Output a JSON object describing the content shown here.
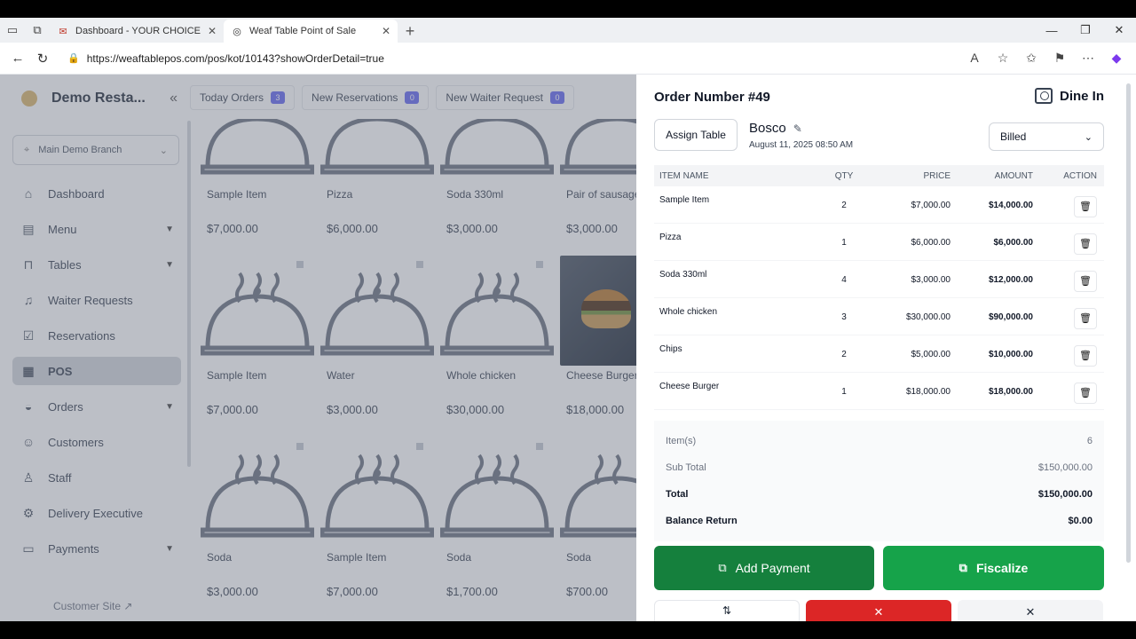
{
  "browser": {
    "tabs": [
      {
        "title": "Dashboard - YOUR CHOICE LIMIT",
        "active": false
      },
      {
        "title": "Weaf Table Point of Sale",
        "active": true
      }
    ],
    "url": "https://weaftablepos.com/pos/kot/10143?showOrderDetail=true"
  },
  "sidebar": {
    "brand": "Demo Resta...",
    "branch": "Main Demo Branch",
    "items": [
      {
        "label": "Dashboard",
        "icon": "home-icon"
      },
      {
        "label": "Menu",
        "icon": "menu-book-icon",
        "expandable": true
      },
      {
        "label": "Tables",
        "icon": "table-icon",
        "expandable": true
      },
      {
        "label": "Waiter Requests",
        "icon": "bell-icon"
      },
      {
        "label": "Reservations",
        "icon": "calendar-check-icon"
      },
      {
        "label": "POS",
        "icon": "pos-icon",
        "active": true
      },
      {
        "label": "Orders",
        "icon": "orders-icon",
        "expandable": true
      },
      {
        "label": "Customers",
        "icon": "users-icon"
      },
      {
        "label": "Staff",
        "icon": "user-icon"
      },
      {
        "label": "Delivery Executive",
        "icon": "delivery-icon"
      },
      {
        "label": "Payments",
        "icon": "wallet-icon",
        "expandable": true
      }
    ],
    "customer_site": "Customer Site"
  },
  "topnav": [
    {
      "label": "Today Orders",
      "count": "3"
    },
    {
      "label": "New Reservations",
      "count": "0"
    },
    {
      "label": "New Waiter Request",
      "count": "0"
    }
  ],
  "menu_items": [
    {
      "name": "Sample Item",
      "price": "$7,000.00"
    },
    {
      "name": "Pizza",
      "price": "$6,000.00"
    },
    {
      "name": "Soda 330ml",
      "price": "$3,000.00"
    },
    {
      "name": "Pair of sausage",
      "price": "$3,000.00"
    },
    {
      "name": "Sample Item",
      "price": "$7,000.00"
    },
    {
      "name": "Water",
      "price": "$3,000.00"
    },
    {
      "name": "Whole chicken",
      "price": "$30,000.00"
    },
    {
      "name": "Cheese Burger",
      "price": "$18,000.00"
    },
    {
      "name": "Soda",
      "price": "$3,000.00"
    },
    {
      "name": "Sample Item",
      "price": "$7,000.00"
    },
    {
      "name": "Soda",
      "price": "$1,700.00"
    },
    {
      "name": "Soda",
      "price": "$700.00"
    }
  ],
  "order": {
    "title": "Order Number #49",
    "type": "Dine In",
    "assign_table": "Assign Table",
    "customer": "Bosco",
    "date": "August 11, 2025 08:50 AM",
    "status": "Billed",
    "columns": [
      "ITEM NAME",
      "QTY",
      "PRICE",
      "AMOUNT",
      "ACTION"
    ],
    "rows": [
      {
        "name": "Sample Item",
        "qty": "2",
        "price": "$7,000.00",
        "amount": "$14,000.00"
      },
      {
        "name": "Pizza",
        "qty": "1",
        "price": "$6,000.00",
        "amount": "$6,000.00"
      },
      {
        "name": "Soda 330ml",
        "qty": "4",
        "price": "$3,000.00",
        "amount": "$12,000.00"
      },
      {
        "name": "Whole chicken",
        "qty": "3",
        "price": "$30,000.00",
        "amount": "$90,000.00"
      },
      {
        "name": "Chips",
        "qty": "2",
        "price": "$5,000.00",
        "amount": "$10,000.00"
      },
      {
        "name": "Cheese Burger",
        "qty": "1",
        "price": "$18,000.00",
        "amount": "$18,000.00"
      }
    ],
    "summary": {
      "items_label": "Item(s)",
      "items_value": "6",
      "subtotal_label": "Sub Total",
      "subtotal_value": "$150,000.00",
      "total_label": "Total",
      "total_value": "$150,000.00",
      "balance_label": "Balance Return",
      "balance_value": "$0.00"
    },
    "add_payment": "Add Payment",
    "fiscalize": "Fiscalize"
  }
}
